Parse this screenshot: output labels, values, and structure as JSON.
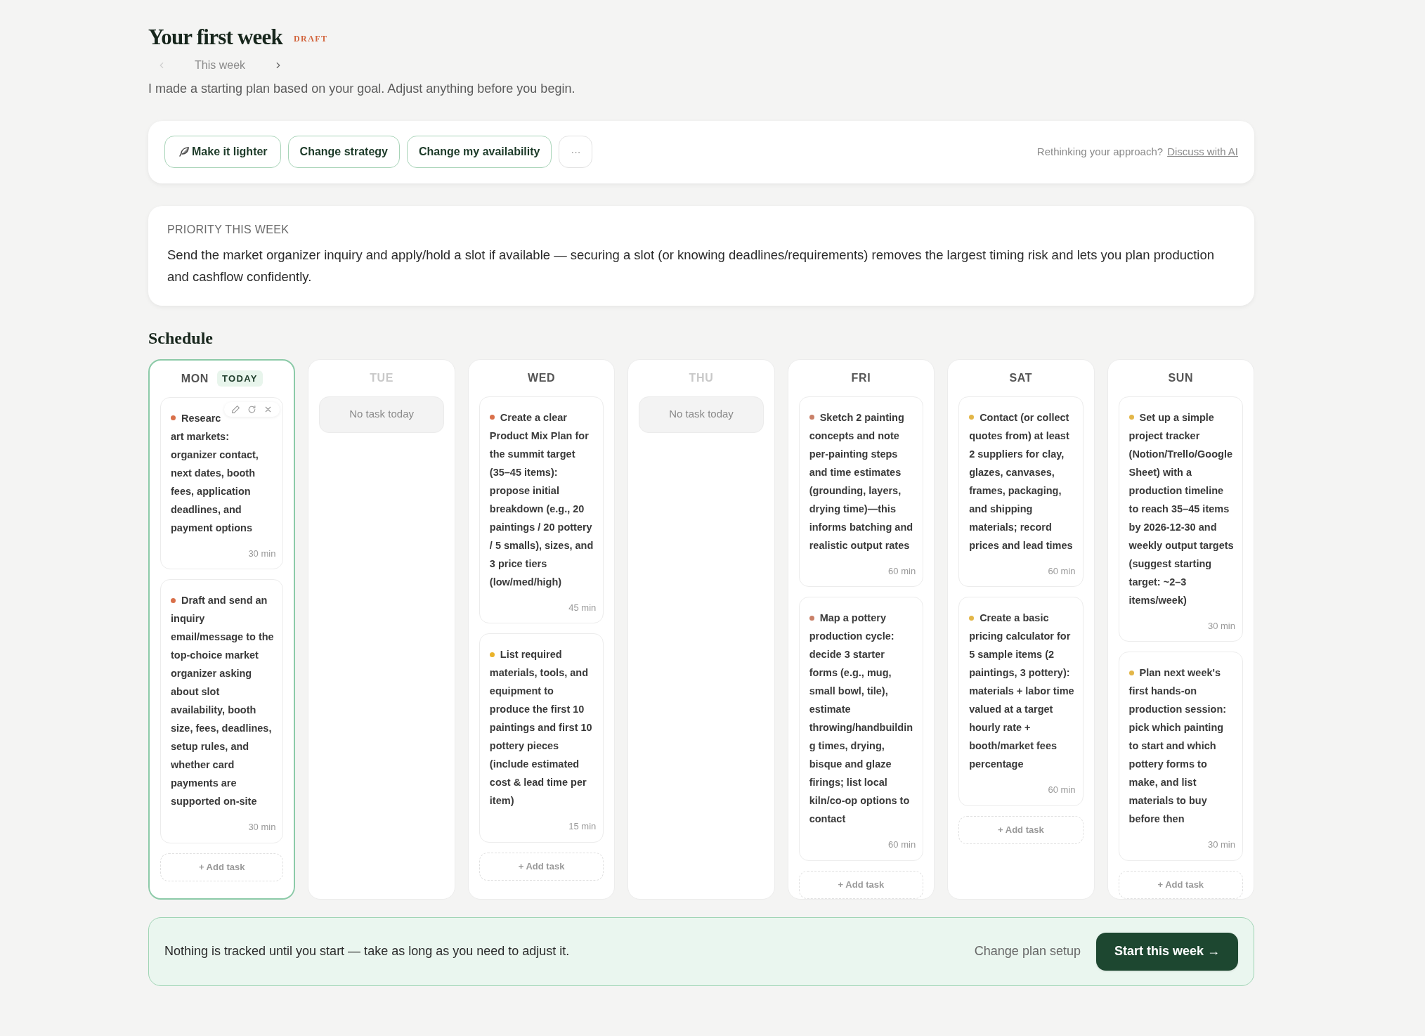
{
  "header": {
    "title": "Your first week",
    "badge": "DRAFT",
    "week_label": "This week",
    "prev_disabled": true,
    "subtitle": "I made a starting plan based on your goal. Adjust anything before you begin."
  },
  "actions": {
    "buttons": [
      {
        "label": "Make it lighter",
        "kind": "feather"
      },
      {
        "label": "Change strategy",
        "kind": "plain"
      },
      {
        "label": "Change my availability",
        "kind": "plain"
      },
      {
        "label": "···",
        "kind": "more"
      }
    ],
    "hint": "Rethinking your approach?",
    "link": "Discuss with AI"
  },
  "priority": {
    "heading": "PRIORITY THIS WEEK",
    "text": "Send the market organizer inquiry and apply/hold a slot if available — securing a slot (or knowing deadlines/requirements) removes the largest timing risk and lets you plan production and cashflow confidently."
  },
  "schedule": {
    "title": "Schedule",
    "days": [
      {
        "name": "MON",
        "today": true,
        "today_badge": "TODAY",
        "add_label": "+ Add task",
        "tasks": [
          {
            "title": "Researc",
            "title_continued": "art markets: organizer contact, next dates, booth fees, application deadlines, and payment options",
            "duration": "30 min",
            "color": "#d9704a",
            "toolbar": true
          },
          {
            "title": "Draft and send an inquiry email/message to the top-choice market organizer asking about slot availability, booth size, fees, deadlines, setup rules, and whether card payments are supported on-site",
            "duration": "30 min",
            "color": "#d9704a",
            "toolbar": false
          }
        ]
      },
      {
        "name": "TUE",
        "today": false,
        "empty_label": "No task today"
      },
      {
        "name": "WED",
        "today": false,
        "add_label": "+ Add task",
        "tasks": [
          {
            "title": "Create a clear Product Mix Plan for the summit target (35–45 items): propose initial breakdown (e.g., 20 paintings / 20 pottery / 5 smalls), sizes, and 3 price tiers (low/med/high)",
            "duration": "45 min",
            "color": "#d9704a",
            "toolbar": false
          },
          {
            "title": "List required materials, tools, and equipment to produce the first 10 paintings and first 10 pottery pieces (include estimated cost & lead time per item)",
            "duration": "15 min",
            "color": "#eab32a",
            "toolbar": false
          }
        ]
      },
      {
        "name": "THU",
        "today": false,
        "empty_label": "No task today"
      },
      {
        "name": "FRI",
        "today": false,
        "add_label": "+ Add task",
        "tasks": [
          {
            "title": "Sketch 2 painting concepts and note per-painting steps and time estimates (grounding, layers, drying time)—this informs batching and realistic output rates",
            "duration": "60 min",
            "color": "#c98068",
            "toolbar": false
          },
          {
            "title": "Map a pottery production cycle: decide 3 starter forms (e.g., mug, small bowl, tile), estimate throwing/handbuilding times, drying, bisque and glaze firings; list local kiln/co-op options to contact",
            "duration": "60 min",
            "color": "#c98068",
            "toolbar": false
          }
        ]
      },
      {
        "name": "SAT",
        "today": false,
        "add_label": "+ Add task",
        "tasks": [
          {
            "title": "Contact (or collect quotes from) at least 2 suppliers for clay, glazes, canvases, frames, packaging, and shipping materials; record prices and lead times",
            "duration": "60 min",
            "color": "#e3b648",
            "toolbar": false
          },
          {
            "title": "Create a basic pricing calculator for 5 sample items (2 paintings, 3 pottery): materials + labor time valued at a target hourly rate + booth/market fees percentage",
            "duration": "60 min",
            "color": "#e3b648",
            "toolbar": false
          }
        ]
      },
      {
        "name": "SUN",
        "today": false,
        "add_label": "+ Add task",
        "tasks": [
          {
            "title": "Set up a simple project tracker (Notion/Trello/Google Sheet) with a production timeline to reach 35–45 items by 2026-12-30 and weekly output targets (suggest starting target: ~2–3 items/week)",
            "duration": "30 min",
            "color": "#e3b648",
            "toolbar": false
          },
          {
            "title": "Plan next week's first hands-on production session: pick which painting to start and which pottery forms to make, and list materials to buy before then",
            "duration": "30 min",
            "color": "#e3b648",
            "toolbar": false
          }
        ]
      }
    ]
  },
  "footer": {
    "note": "Nothing is tracked until you start — take as long as you need to adjust it.",
    "secondary": "Change plan setup",
    "primary": "Start this week →"
  }
}
